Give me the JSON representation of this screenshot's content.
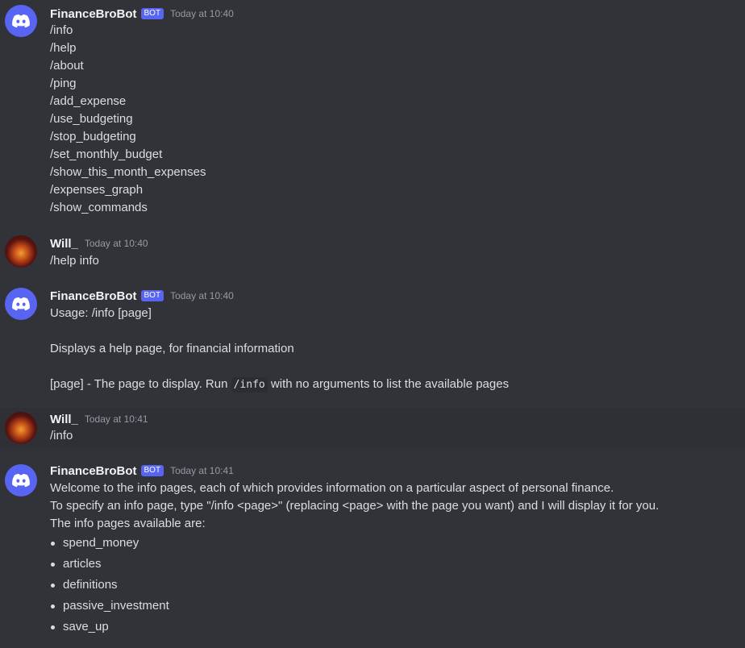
{
  "users": {
    "bot_name": "FinanceBroBot",
    "bot_tag": "BOT",
    "user_name": "Will_"
  },
  "messages": [
    {
      "author": "FinanceBroBot",
      "is_bot": true,
      "timestamp": "Today at 10:40",
      "lines": [
        "/info",
        "/help",
        "/about",
        "/ping",
        "/add_expense",
        "/use_budgeting",
        "/stop_budgeting",
        "/set_monthly_budget",
        "/show_this_month_expenses",
        "/expenses_graph",
        "/show_commands"
      ]
    },
    {
      "author": "Will_",
      "is_bot": false,
      "timestamp": "Today at 10:40",
      "text": "/help info"
    },
    {
      "author": "FinanceBroBot",
      "is_bot": true,
      "timestamp": "Today at 10:40",
      "usage": "Usage: /info [page]",
      "description": "Displays a help page, for financial information",
      "param_pre": "[page] - The page to display. Run ",
      "param_code": "/info",
      "param_post": " with no arguments to list the available pages"
    },
    {
      "author": "Will_",
      "is_bot": false,
      "timestamp": "Today at 10:41",
      "text": "/info"
    },
    {
      "author": "FinanceBroBot",
      "is_bot": true,
      "timestamp": "Today at 10:41",
      "lines": [
        "Welcome to the info pages, each of which provides information on a particular aspect of personal finance.",
        "To specify an info page, type \"/info <page>\" (replacing <page> with the page you want) and I will display it for you.",
        "The info pages available are:"
      ],
      "pages": [
        "spend_money",
        "articles",
        "definitions",
        "passive_investment",
        "save_up"
      ]
    }
  ],
  "colors": {
    "background": "#313338",
    "hover_background": "#2e3035",
    "blurple": "#5865f2",
    "text": "#dbdee1",
    "author": "#f2f3f5",
    "timestamp": "#949ba4"
  },
  "icons": {
    "bot_avatar": "discord-logo-icon",
    "user_avatar": "user-avatar-icon"
  }
}
